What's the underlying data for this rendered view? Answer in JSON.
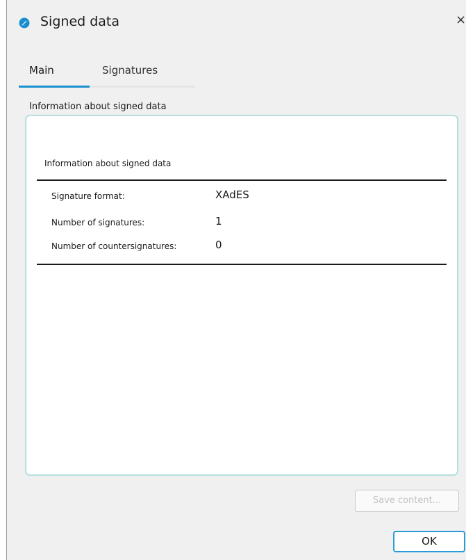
{
  "window": {
    "title": "Signed data",
    "close_glyph": "×",
    "icon": "app-logo-icon",
    "accent_color": "#1a8fd0"
  },
  "tabs": [
    {
      "label": "Main",
      "active": true
    },
    {
      "label": "Signatures",
      "active": false
    }
  ],
  "group": {
    "label": "Information about signed data",
    "inner_title": "Information about signed data",
    "rows": [
      {
        "label": "Signature format:",
        "value": "XAdES"
      },
      {
        "label": "Number of signatures:",
        "value": "1"
      },
      {
        "label": "Number of countersignatures:",
        "value": "0"
      }
    ]
  },
  "buttons": {
    "save_content": {
      "label": "Save content...",
      "enabled": false
    },
    "ok": {
      "label": "OK",
      "enabled": true
    }
  }
}
